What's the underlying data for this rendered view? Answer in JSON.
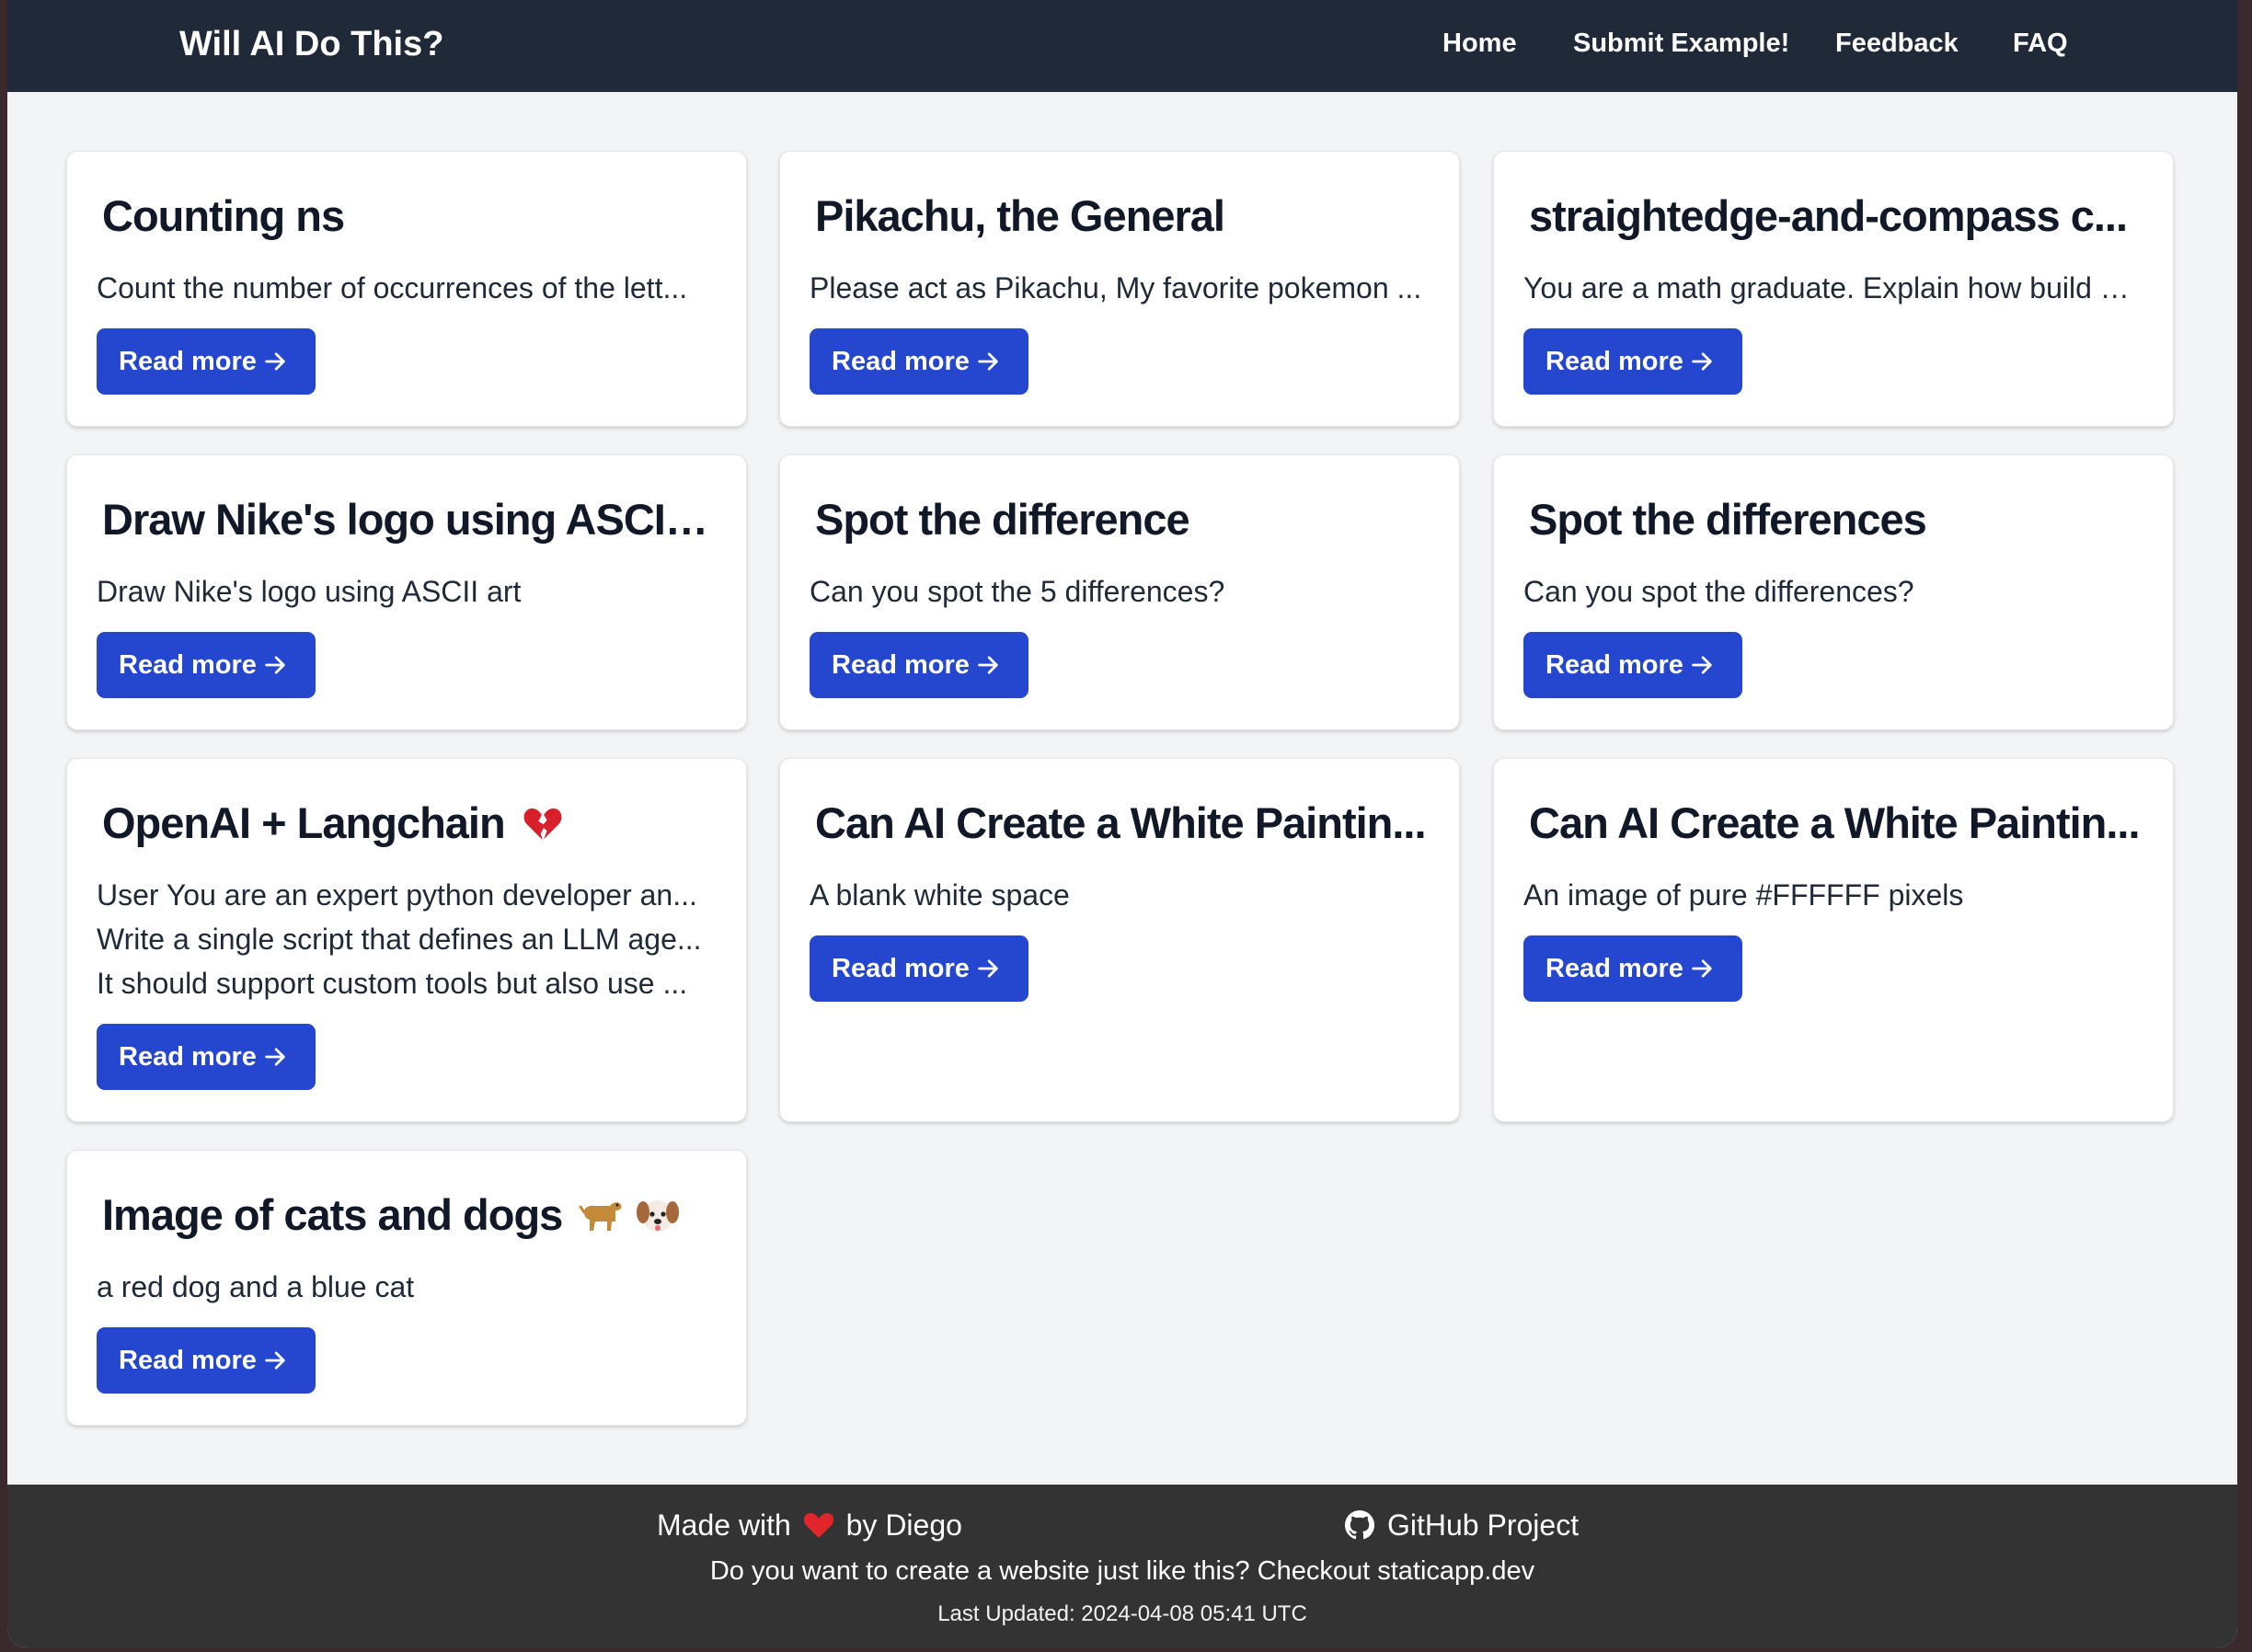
{
  "header": {
    "brand": "Will AI Do This?",
    "nav": [
      {
        "label": "Home"
      },
      {
        "label": "Submit Example!"
      },
      {
        "label": "Feedback"
      },
      {
        "label": "FAQ"
      }
    ]
  },
  "cards": [
    {
      "title": "Counting ns",
      "lines": [
        "Count the number of occurrences of the lett..."
      ],
      "button": "Read more"
    },
    {
      "title": "Pikachu, the General",
      "lines": [
        "Please act as Pikachu, My favorite pokemon ..."
      ],
      "button": "Read more"
    },
    {
      "title": "straightedge-and-compass c...",
      "lines": [
        "You are a math graduate. Explain how build a..."
      ],
      "button": "Read more"
    },
    {
      "title": "Draw Nike's logo using ASCII ...",
      "lines": [
        "Draw Nike's logo using ASCII art"
      ],
      "button": "Read more"
    },
    {
      "title": "Spot the difference",
      "lines": [
        "Can you spot the 5 differences?"
      ],
      "button": "Read more"
    },
    {
      "title": "Spot the differences",
      "lines": [
        "Can you spot the differences?"
      ],
      "button": "Read more"
    },
    {
      "title": "OpenAI + Langchain",
      "title_icon": "broken-heart-icon",
      "lines": [
        "User You are an expert python developer an...",
        "Write a single script that defines an LLM age...",
        "It should support custom tools but also use ..."
      ],
      "button": "Read more"
    },
    {
      "title": "Can AI Create a White Paintin...",
      "lines": [
        "A blank white space"
      ],
      "button": "Read more"
    },
    {
      "title": "Can AI Create a White Paintin...",
      "lines": [
        "An image of pure #FFFFFF pixels"
      ],
      "button": "Read more"
    },
    {
      "title": "Image of cats and dogs",
      "title_icon": "dog-emoji-icons",
      "lines": [
        "a red dog and a blue cat"
      ],
      "button": "Read more"
    }
  ],
  "footer": {
    "made_prefix": "Made with",
    "made_suffix": "by Diego",
    "github_label": "GitHub Project",
    "cta": "Do you want to create a website just like this? Checkout staticapp.dev",
    "updated": "Last Updated: 2024-04-08 05:41 UTC"
  },
  "colors": {
    "navbar": "#1f2937",
    "background": "#f3f4f6",
    "button": "#2547d0",
    "footer": "#333333",
    "heart": "#e0262b"
  }
}
